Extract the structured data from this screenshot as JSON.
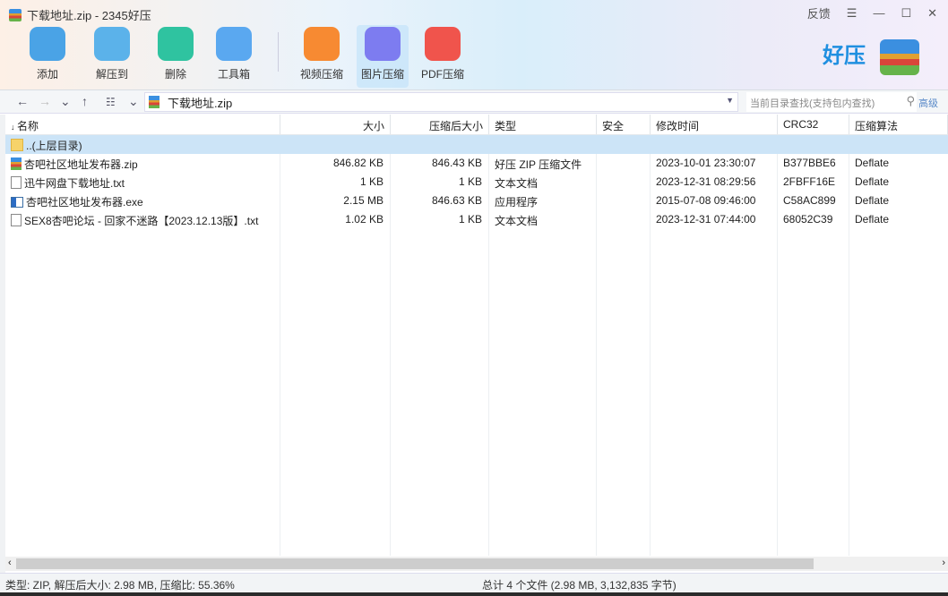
{
  "window": {
    "title": "下载地址.zip - 2345好压",
    "feedback": "反馈"
  },
  "toolbar": [
    {
      "label": "添加",
      "color": "#4aa3e6"
    },
    {
      "label": "解压到",
      "color": "#5bb2ea"
    },
    {
      "label": "删除",
      "color": "#2fc3a0"
    },
    {
      "label": "工具箱",
      "color": "#5aa8f0"
    },
    {
      "label": "视频压缩",
      "color": "#f78a32"
    },
    {
      "label": "图片压缩",
      "color": "#7d7cf0"
    },
    {
      "label": "PDF压缩",
      "color": "#f0544c"
    }
  ],
  "brand": {
    "logo_text": "好压"
  },
  "nav": {
    "path": "下载地址.zip",
    "search_placeholder": "当前目录查找(支持包内查找)",
    "advanced": "高级"
  },
  "columns": [
    "名称",
    "大小",
    "压缩后大小",
    "类型",
    "安全",
    "修改时间",
    "CRC32",
    "压缩算法"
  ],
  "rows": [
    {
      "icon": "folder",
      "name": "..(上层目录)",
      "size": "",
      "packed": "",
      "type": "",
      "security": "",
      "mtime": "",
      "crc": "",
      "method": ""
    },
    {
      "icon": "zip",
      "name": "杏吧社区地址发布器.zip",
      "size": "846.82 KB",
      "packed": "846.43 KB",
      "type": "好压 ZIP 压缩文件",
      "security": "",
      "mtime": "2023-10-01 23:30:07",
      "crc": "B377BBE6",
      "method": "Deflate"
    },
    {
      "icon": "txt",
      "name": "迅牛网盘下载地址.txt",
      "size": "1 KB",
      "packed": "1 KB",
      "type": "文本文档",
      "security": "",
      "mtime": "2023-12-31 08:29:56",
      "crc": "2FBFF16E",
      "method": "Deflate"
    },
    {
      "icon": "exe",
      "name": "杏吧社区地址发布器.exe",
      "size": "2.15 MB",
      "packed": "846.63 KB",
      "type": "应用程序",
      "security": "",
      "mtime": "2015-07-08 09:46:00",
      "crc": "C58AC899",
      "method": "Deflate"
    },
    {
      "icon": "txt",
      "name": "SEX8杏吧论坛 - 回家不迷路【2023.12.13版】.txt",
      "size": "1.02 KB",
      "packed": "1 KB",
      "type": "文本文档",
      "security": "",
      "mtime": "2023-12-31 07:44:00",
      "crc": "68052C39",
      "method": "Deflate"
    }
  ],
  "status": {
    "left": "类型: ZIP, 解压后大小: 2.98 MB, 压缩比: 55.36%",
    "right": "总计 4 个文件 (2.98 MB, 3,132,835 字节)"
  }
}
